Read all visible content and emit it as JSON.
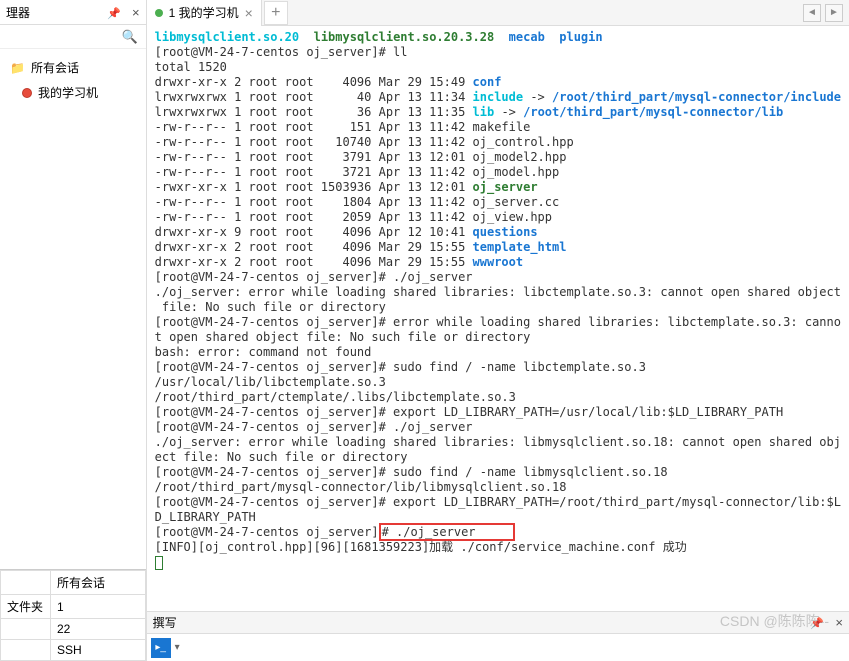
{
  "left": {
    "title": "理器",
    "all_sessions": "所有会话",
    "session1": "我的学习机",
    "table": {
      "col_header": "所有会话",
      "row1_label": "文件夹",
      "row1_val": "1",
      "row2_label": "",
      "row2_val": "22",
      "row3_label": "",
      "row3_val": "SSH"
    }
  },
  "tabs": {
    "active_label": "1 我的学习机"
  },
  "terminal": {
    "lib1": "libmysqlclient.so.20",
    "lib2": "libmysqlclient.so.20.3.28",
    "lib3": "mecab",
    "lib4": "plugin",
    "prompt1": "[root@VM-24-7-centos oj_server]# ll",
    "total": "total 1520",
    "l1a": "drwxr-xr-x 2 root root    4096 Mar 29 15:49 ",
    "l1b": "conf",
    "l2a": "lrwxrwxrwx 1 root root      40 Apr 13 11:34 ",
    "l2b": "include",
    "l2c": " -> ",
    "l2d": "/root/third_part/mysql-connector/include",
    "l3a": "lrwxrwxrwx 1 root root      36 Apr 13 11:35 ",
    "l3b": "lib",
    "l3c": " -> ",
    "l3d": "/root/third_part/mysql-connector/lib",
    "l4": "-rw-r--r-- 1 root root     151 Apr 13 11:42 makefile",
    "l5": "-rw-r--r-- 1 root root   10740 Apr 13 11:42 oj_control.hpp",
    "l6": "-rw-r--r-- 1 root root    3791 Apr 13 12:01 oj_model2.hpp",
    "l7": "-rw-r--r-- 1 root root    3721 Apr 13 11:42 oj_model.hpp",
    "l8a": "-rwxr-xr-x 1 root root 1503936 Apr 13 12:01 ",
    "l8b": "oj_server",
    "l9": "-rw-r--r-- 1 root root    1804 Apr 13 11:42 oj_server.cc",
    "l10": "-rw-r--r-- 1 root root    2059 Apr 13 11:42 oj_view.hpp",
    "l11a": "drwxr-xr-x 9 root root    4096 Apr 12 10:41 ",
    "l11b": "questions",
    "l12a": "drwxr-xr-x 2 root root    4096 Mar 29 15:55 ",
    "l12b": "template_html",
    "l13a": "drwxr-xr-x 2 root root    4096 Mar 29 15:55 ",
    "l13b": "wwwroot",
    "p2": "[root@VM-24-7-centos oj_server]# ./oj_server",
    "e1": "./oj_server: error while loading shared libraries: libctemplate.so.3: cannot open shared object",
    "e1b": " file: No such file or directory",
    "p3": "[root@VM-24-7-centos oj_server]# error while loading shared libraries: libctemplate.so.3: canno",
    "e2": "t open shared object file: No such file or directory",
    "e3": "bash: error: command not found",
    "p4": "[root@VM-24-7-centos oj_server]# sudo find / -name libctemplate.so.3",
    "f1": "/usr/local/lib/libctemplate.so.3",
    "f2": "/root/third_part/ctemplate/.libs/libctemplate.so.3",
    "p5": "[root@VM-24-7-centos oj_server]# export LD_LIBRARY_PATH=/usr/local/lib:$LD_LIBRARY_PATH",
    "p6": "[root@VM-24-7-centos oj_server]# ./oj_server",
    "e4": "./oj_server: error while loading shared libraries: libmysqlclient.so.18: cannot open shared obj",
    "e4b": "ect file: No such file or directory",
    "p7": "[root@VM-24-7-centos oj_server]# sudo find / -name libmysqlclient.so.18",
    "f3": "/root/third_part/mysql-connector/lib/libmysqlclient.so.18",
    "p8": "[root@VM-24-7-centos oj_server]# export LD_LIBRARY_PATH=/root/third_part/mysql-connector/lib:$L",
    "p8b": "D_LIBRARY_PATH",
    "p9a": "[root@VM-24-7-centos oj_server]",
    "p9b": "# ./oj_server",
    "info": "[INFO][oj_control.hpp][96][1681359223]加载 ./conf/service_machine.conf 成功"
  },
  "compose": {
    "label": "撰写"
  },
  "watermark": "CSDN @陈陈陈--"
}
